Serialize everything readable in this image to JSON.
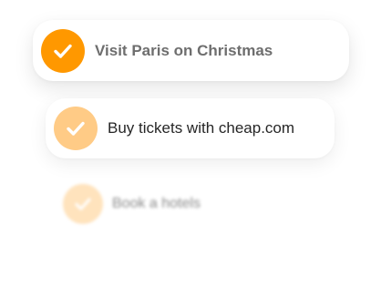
{
  "tasks": [
    {
      "label": "Visit Paris on Christmas",
      "checked": true,
      "check_color": "#ff9800"
    },
    {
      "label": "Buy tickets with cheap.com",
      "checked": true,
      "check_color": "#ffcb86"
    },
    {
      "label": "Book a hotels",
      "checked": true,
      "check_color": "#ffe3bd"
    }
  ],
  "colors": {
    "accent": "#ff9800",
    "card_background": "#ffffff",
    "check_mark": "#ffffff"
  }
}
